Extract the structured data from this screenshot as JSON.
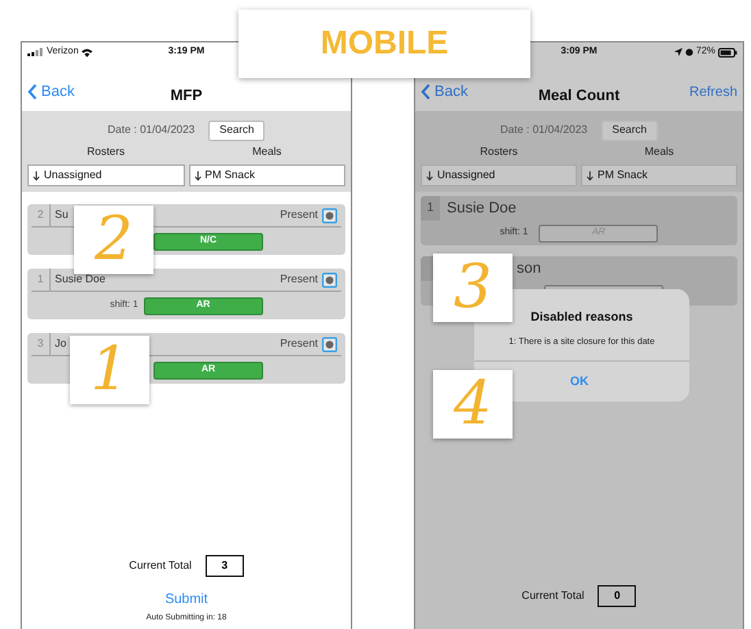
{
  "banner": {
    "title": "MOBILE"
  },
  "screens": [
    {
      "status_bar": {
        "carrier": "Verizon",
        "time": "3:19 PM"
      },
      "nav": {
        "back": "Back",
        "title": "MFP"
      },
      "dimmed": false,
      "filters": {
        "date": "Date : 01/04/2023",
        "search": "Search",
        "rosters_label": "Rosters",
        "rosters_value": "Unassigned",
        "meals_label": "Meals",
        "meals_value": "PM Snack"
      },
      "cards": [
        {
          "kind": "present",
          "number": "2",
          "name": "Su",
          "status": "Present",
          "meal": "N/C",
          "enabled": true
        },
        {
          "kind": "present",
          "number": "1",
          "name": "Susie Doe",
          "status": "Present",
          "shift": "shift: 1",
          "meal": "AR",
          "enabled": true
        },
        {
          "kind": "present",
          "number": "3",
          "name": "Jo",
          "status": "Present",
          "meal": "AR",
          "enabled": true
        }
      ],
      "footer": {
        "total_label": "Current Total",
        "total": "3",
        "submit": "Submit",
        "auto_submit": "Auto Submitting in: 18"
      }
    },
    {
      "status_bar": {
        "time": "3:09 PM",
        "battery": "72%"
      },
      "nav": {
        "back": "Back",
        "title": "Meal Count",
        "refresh": "Refresh"
      },
      "dimmed": true,
      "filters": {
        "date": "Date : 01/04/2023",
        "search": "Search",
        "rosters_label": "Rosters",
        "rosters_value": "Unassigned",
        "meals_label": "Meals",
        "meals_value": "PM Snack"
      },
      "cards": [
        {
          "kind": "count",
          "number": "1",
          "name": "Susie Doe",
          "shift": "shift: 1",
          "meal": "AR",
          "enabled": false
        },
        {
          "kind": "count",
          "name": "son",
          "enabled": false
        }
      ],
      "dialog": {
        "title": "Disabled reasons",
        "message": "1: There is a site closure for this date",
        "button": "OK"
      },
      "footer": {
        "total_label": "Current Total",
        "total": "0"
      }
    }
  ],
  "annotations": [
    {
      "label": "2"
    },
    {
      "label": "1"
    },
    {
      "label": "3"
    },
    {
      "label": "4"
    }
  ]
}
